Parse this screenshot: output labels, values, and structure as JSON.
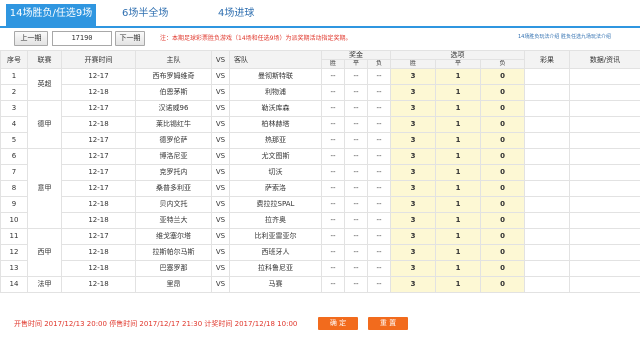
{
  "tabs": [
    {
      "label": "14场胜负/任选9场"
    },
    {
      "label": "6场半全场"
    },
    {
      "label": "4场进球"
    }
  ],
  "toolbar": {
    "prev_label": "上一期",
    "issue_value": "17190",
    "next_label": "下一期",
    "notice": "注：本期足球彩票胜负游戏（14场和任选9场）为派奖期活动指定奖期。",
    "link1": "14场胜负玩法介绍",
    "link2": "胜负任选九场玩法介绍"
  },
  "table": {
    "headers": {
      "index": "序号",
      "league": "联赛",
      "time": "开赛时间",
      "home": "主队",
      "vs": "VS",
      "away": "客队",
      "odds": "奖金",
      "picks": "选项",
      "lottery": "彩果",
      "info": "数据/资讯"
    },
    "sub_headers": [
      "胜",
      "平",
      "负",
      "胜",
      "平",
      "负"
    ],
    "leagues": [
      {
        "name": "英超",
        "first_row": 1,
        "span": 2
      },
      {
        "name": "德甲",
        "first_row": 3,
        "span": 3
      },
      {
        "name": "意甲",
        "first_row": 6,
        "span": 5
      },
      {
        "name": "西甲",
        "first_row": 11,
        "span": 3
      },
      {
        "name": "法甲",
        "first_row": 14,
        "span": 1
      }
    ],
    "rows": [
      {
        "no": "1",
        "date": "12-17",
        "home": "西布罗姆维奇",
        "vs": "VS",
        "away": "曼彻斯特联",
        "o1": "--",
        "o2": "--",
        "o3": "--",
        "p1": "3",
        "p2": "1",
        "p3": "0"
      },
      {
        "no": "2",
        "date": "12-18",
        "home": "伯恩茅斯",
        "vs": "VS",
        "away": "利物浦",
        "o1": "--",
        "o2": "--",
        "o3": "--",
        "p1": "3",
        "p2": "1",
        "p3": "0"
      },
      {
        "no": "3",
        "date": "12-17",
        "home": "汉诺威96",
        "vs": "VS",
        "away": "勒沃库森",
        "o1": "--",
        "o2": "--",
        "o3": "--",
        "p1": "3",
        "p2": "1",
        "p3": "0"
      },
      {
        "no": "4",
        "date": "12-18",
        "home": "莱比锡红牛",
        "vs": "VS",
        "away": "柏林赫塔",
        "o1": "--",
        "o2": "--",
        "o3": "--",
        "p1": "3",
        "p2": "1",
        "p3": "0"
      },
      {
        "no": "5",
        "date": "12-17",
        "home": "德罗伦萨",
        "vs": "VS",
        "away": "热那亚",
        "o1": "--",
        "o2": "--",
        "o3": "--",
        "p1": "3",
        "p2": "1",
        "p3": "0"
      },
      {
        "no": "6",
        "date": "12-17",
        "home": "博洛尼亚",
        "vs": "VS",
        "away": "尤文图斯",
        "o1": "--",
        "o2": "--",
        "o3": "--",
        "p1": "3",
        "p2": "1",
        "p3": "0"
      },
      {
        "no": "7",
        "date": "12-17",
        "home": "克罗托内",
        "vs": "VS",
        "away": "切沃",
        "o1": "--",
        "o2": "--",
        "o3": "--",
        "p1": "3",
        "p2": "1",
        "p3": "0"
      },
      {
        "no": "8",
        "date": "12-17",
        "home": "桑普多利亚",
        "vs": "VS",
        "away": "萨索洛",
        "o1": "--",
        "o2": "--",
        "o3": "--",
        "p1": "3",
        "p2": "1",
        "p3": "0"
      },
      {
        "no": "9",
        "date": "12-18",
        "home": "贝内文托",
        "vs": "VS",
        "away": "费拉拉SPAL",
        "o1": "--",
        "o2": "--",
        "o3": "--",
        "p1": "3",
        "p2": "1",
        "p3": "0"
      },
      {
        "no": "10",
        "date": "12-18",
        "home": "亚特兰大",
        "vs": "VS",
        "away": "拉齐奥",
        "o1": "--",
        "o2": "--",
        "o3": "--",
        "p1": "3",
        "p2": "1",
        "p3": "0"
      },
      {
        "no": "11",
        "date": "12-17",
        "home": "维戈塞尔塔",
        "vs": "VS",
        "away": "比利亚雷亚尔",
        "o1": "--",
        "o2": "--",
        "o3": "--",
        "p1": "3",
        "p2": "1",
        "p3": "0"
      },
      {
        "no": "12",
        "date": "12-18",
        "home": "拉斯帕尔马斯",
        "vs": "VS",
        "away": "西班牙人",
        "o1": "--",
        "o2": "--",
        "o3": "--",
        "p1": "3",
        "p2": "1",
        "p3": "0"
      },
      {
        "no": "13",
        "date": "12-18",
        "home": "巴塞罗那",
        "vs": "VS",
        "away": "拉科鲁尼亚",
        "o1": "--",
        "o2": "--",
        "o3": "--",
        "p1": "3",
        "p2": "1",
        "p3": "0"
      },
      {
        "no": "14",
        "date": "12-18",
        "home": "里昂",
        "vs": "VS",
        "away": "马赛",
        "o1": "--",
        "o2": "--",
        "o3": "--",
        "p1": "3",
        "p2": "1",
        "p3": "0"
      }
    ]
  },
  "footer": {
    "times": "开售时间 2017/12/13 20:00   停售时间 2017/12/17 21:30   计奖时间 2017/12/18 10:00",
    "confirm_label": "确 定",
    "reset_label": "重 置"
  },
  "colors": {
    "accent": "#2f96e0",
    "notice": "#e0362b",
    "button": "#f26b1d",
    "pick_bg": "#fdf8d4"
  }
}
